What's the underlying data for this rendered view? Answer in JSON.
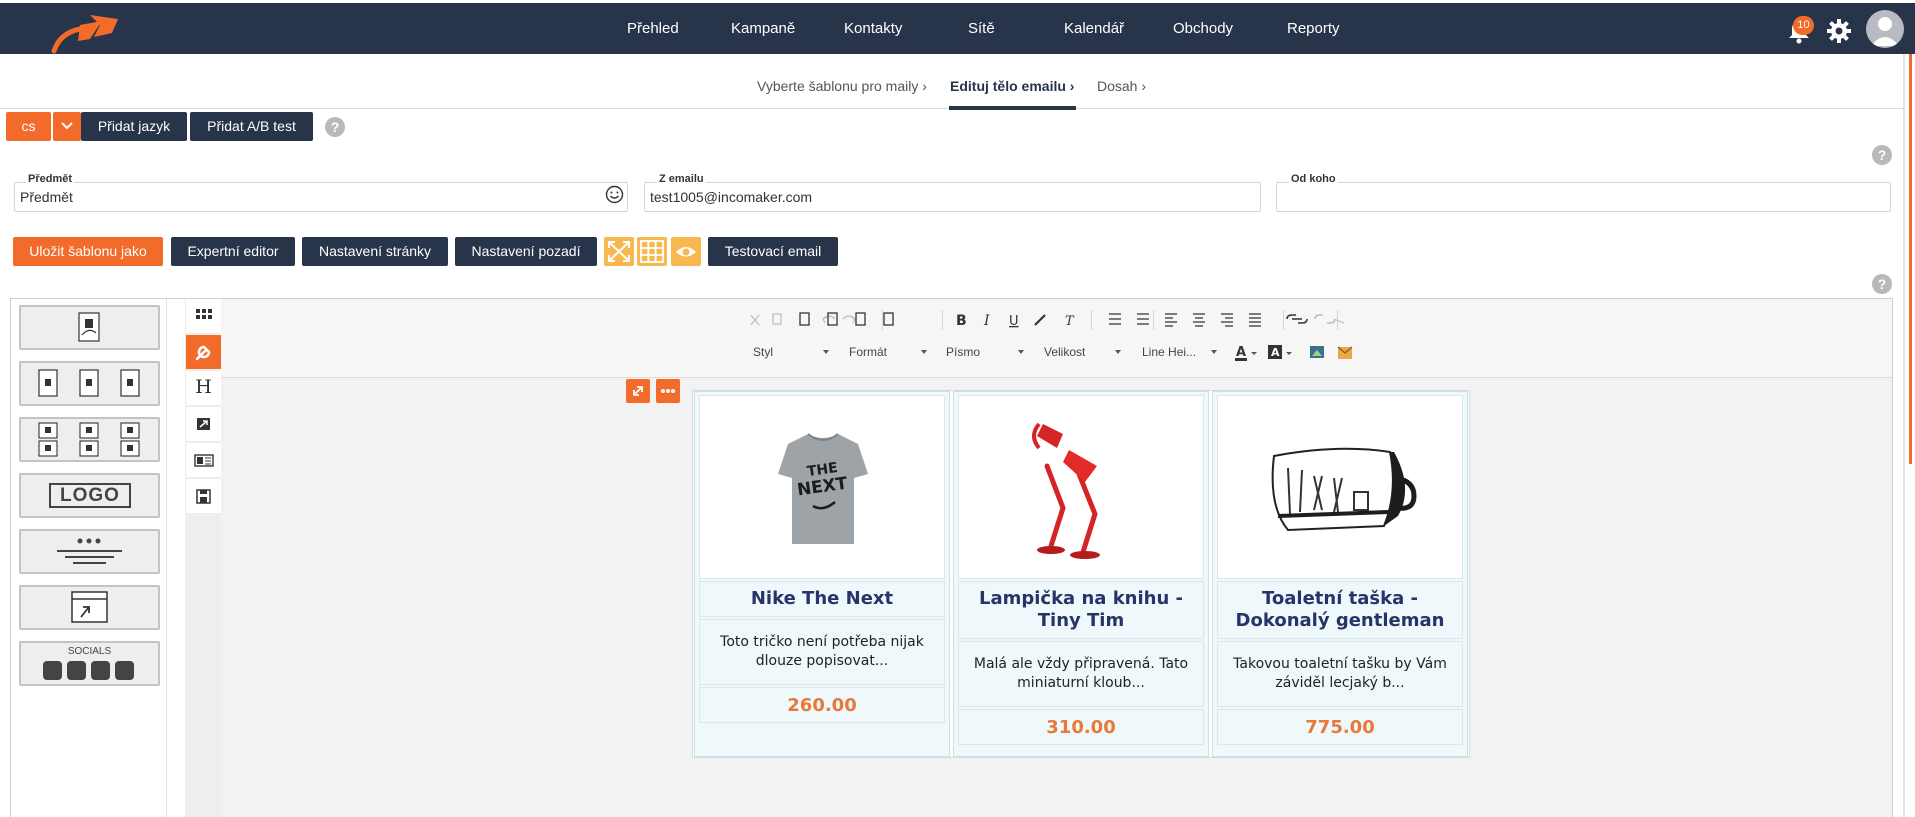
{
  "nav": {
    "items": [
      "Přehled",
      "Kampaně",
      "Kontakty",
      "Sítě",
      "Kalendář",
      "Obchody",
      "Reporty"
    ],
    "notification_count": "10"
  },
  "breadcrumb": {
    "steps": [
      "Vyberte šablonu pro maily",
      "Edituj tělo emailu",
      "Dosah"
    ],
    "active_index": 1
  },
  "language_bar": {
    "language": "cs",
    "add_language": "Přidat jazyk",
    "add_ab_test": "Přidat A/B test",
    "help": "?"
  },
  "fields": {
    "subject_label": "Předmět",
    "subject_value": "Předmět",
    "from_email_label": "Z emailu",
    "from_email_value": "test1005@incomaker.com",
    "from_name_label": "Od koho",
    "from_name_value": ""
  },
  "actions": {
    "save_template": "Uložit šablonu jako",
    "expert_editor": "Expertní editor",
    "page_settings": "Nastavení stránky",
    "background_settings": "Nastavení pozadí",
    "test_email": "Testovací email"
  },
  "blocks": {
    "logo_label": "LOGO",
    "socials_label": "SOCIALS"
  },
  "toolbar": {
    "style": "Styl",
    "format": "Formát",
    "font": "Písmo",
    "size": "Velikost",
    "line_height": "Line Hei..."
  },
  "products": [
    {
      "title": "Nike The Next",
      "description": "Toto tričko není potřeba nijak dlouze popisovat...",
      "price": "260.00"
    },
    {
      "title": "Lampička na knihu - Tiny Tim",
      "description": "Malá ale vždy připravená. Tato miniaturní kloub...",
      "price": "310.00"
    },
    {
      "title": "Toaletní taška - Dokonalý gentleman",
      "description": "Takovou toaletní tašku by Vám záviděl lecjaký b...",
      "price": "775.00"
    }
  ],
  "colors": {
    "navy": "#27344a",
    "orange": "#f26b2a",
    "title_blue": "#27346a",
    "price_orange": "#e8793a"
  }
}
